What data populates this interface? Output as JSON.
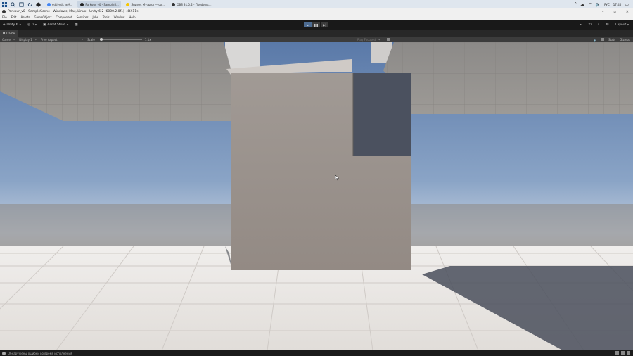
{
  "taskbar": {
    "tabs": [
      {
        "label": "eddysdk @M...",
        "color": "#4285f4"
      },
      {
        "label": "Parkour_v0 - SampleS...",
        "color": "#222222"
      },
      {
        "label": "Яндекс Музыка — со...",
        "color": "#f7c600"
      },
      {
        "label": "OBS 31.0.2 - Профиль...",
        "color": "#333333"
      }
    ],
    "lang": "РУС",
    "time": "17:40"
  },
  "window": {
    "title": "Parkour_v0 - SampleScene - Windows, Mac, Linux - Unity 6.2 (6000.2.0f1) <DX11>"
  },
  "menu": [
    "File",
    "Edit",
    "Assets",
    "GameObject",
    "Component",
    "Services",
    "Jobs",
    "Tools",
    "Window",
    "Help"
  ],
  "toolbar": {
    "account": "Unity 6",
    "count": "0",
    "asset_store": "Asset Store",
    "layout": "Layout"
  },
  "game_tab": {
    "label": "Game"
  },
  "game_toolbar": {
    "display": "Game",
    "display2": "Display 1",
    "aspect": "Free Aspect",
    "scale_label": "Scale",
    "scale_value": "1.1x",
    "play_focused": "Play Focused",
    "stats": "Stats",
    "gizmos": "Gizmos"
  },
  "status": {
    "message": "Обнаружены ошибки во время исполнения"
  },
  "colors": {
    "editor_bg": "#191919",
    "play_active": "#4d6c92",
    "sky_top": "#5a79a8",
    "sky_horizon": "#c2cede",
    "floor": "#e6e2e0",
    "cube": "#9b928c"
  }
}
